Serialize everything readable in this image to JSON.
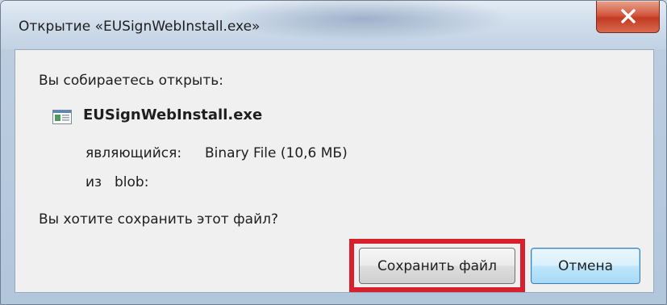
{
  "window": {
    "title": "Открытие «EUSignWebInstall.exe»",
    "close_icon": "close-icon"
  },
  "dialog": {
    "prompt": "Вы собираетесь открыть:",
    "file": {
      "icon": "exe-file-icon",
      "name": "EUSignWebInstall.exe",
      "type_label": "являющийся:",
      "type_value": "Binary File (10,6 МБ)",
      "from_label": "из",
      "from_value": "blob:"
    },
    "question": "Вы хотите сохранить этот файл?",
    "buttons": {
      "save_label": "Сохранить файл",
      "cancel_label": "Отмена"
    },
    "highlight_color": "#d8202c"
  }
}
